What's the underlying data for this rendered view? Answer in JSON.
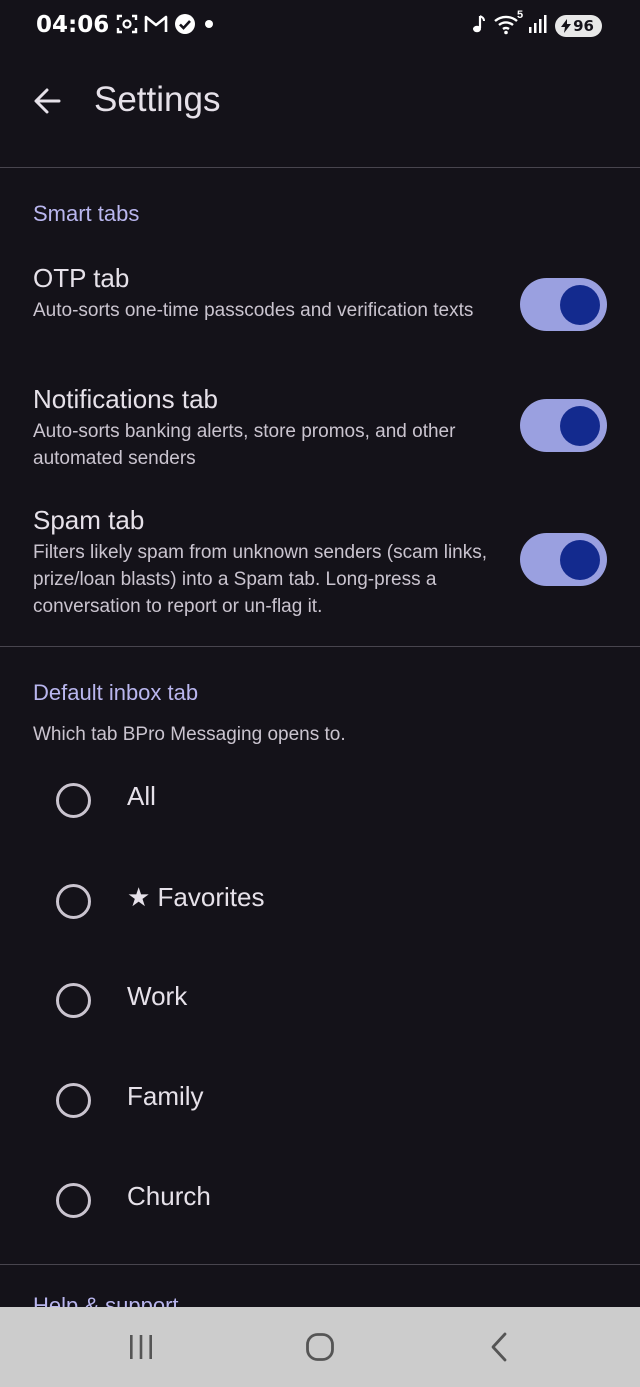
{
  "status_bar": {
    "time": "04:06",
    "left_icons": [
      "screenshot-icon",
      "gmail-icon",
      "check-circle-icon",
      "dot-icon"
    ],
    "right_icons": [
      "music-note-icon",
      "wifi-icon",
      "signal-icon"
    ],
    "wifi_badge": "5",
    "battery_level": "96"
  },
  "app_bar": {
    "title": "Settings"
  },
  "smart_tabs": {
    "header": "Smart tabs",
    "items": [
      {
        "title": "OTP tab",
        "description": "Auto-sorts one-time passcodes and verification texts",
        "enabled": true
      },
      {
        "title": "Notifications tab",
        "description": "Auto-sorts banking alerts, store promos, and other automated senders",
        "enabled": true
      },
      {
        "title": "Spam tab",
        "description": "Filters likely spam from unknown senders (scam links, prize/loan blasts) into a Spam tab. Long-press a conversation to report or un-flag it.",
        "enabled": true
      }
    ]
  },
  "default_inbox": {
    "header": "Default inbox tab",
    "description": "Which tab BPro Messaging opens to.",
    "options": [
      {
        "label": "All",
        "selected": false
      },
      {
        "label": "★ Favorites",
        "selected": false
      },
      {
        "label": "Work",
        "selected": false
      },
      {
        "label": "Family",
        "selected": false
      },
      {
        "label": "Church",
        "selected": false
      }
    ]
  },
  "next_section": {
    "header": "Help & support"
  },
  "colors": {
    "background": "#141219",
    "accent": "#b9b6ee",
    "toggle_track": "#9aa0e0",
    "toggle_knob": "#132a8e",
    "nav_bar": "#cccccc"
  }
}
